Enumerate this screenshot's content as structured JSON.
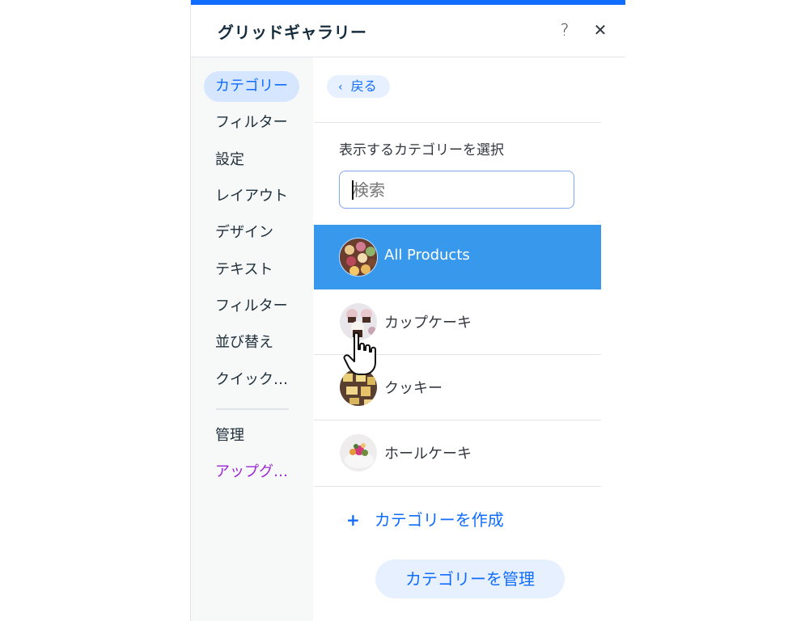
{
  "header": {
    "title": "グリッドギャラリー",
    "help_icon": "?",
    "close_icon": "✕"
  },
  "colors": {
    "accent": "#116dff",
    "selected_row": "#3899ec",
    "upgrade": "#9a27d5"
  },
  "sidebar": {
    "items": [
      {
        "label": "カテゴリー",
        "active": true
      },
      {
        "label": "フィルター"
      },
      {
        "label": "設定"
      },
      {
        "label": "レイアウト"
      },
      {
        "label": "デザイン"
      },
      {
        "label": "テキスト"
      },
      {
        "label": "フィルター"
      },
      {
        "label": "並び替え"
      },
      {
        "label": "クイック…"
      }
    ],
    "secondary": [
      {
        "label": "管理"
      },
      {
        "label": "アップグ…"
      }
    ]
  },
  "content": {
    "back_label": "戻る",
    "back_icon": "‹",
    "section_label": "表示するカテゴリーを選択",
    "search": {
      "placeholder": "検索",
      "value": ""
    },
    "categories": [
      {
        "label": "All Products",
        "selected": true,
        "thumb": "assorted-pastries"
      },
      {
        "label": "カップケーキ",
        "selected": false,
        "thumb": "cupcakes"
      },
      {
        "label": "クッキー",
        "selected": false,
        "thumb": "cookies"
      },
      {
        "label": "ホールケーキ",
        "selected": false,
        "thumb": "whole-cake"
      }
    ],
    "create_icon": "+",
    "create_label": "カテゴリーを作成",
    "manage_label": "カテゴリーを管理"
  }
}
